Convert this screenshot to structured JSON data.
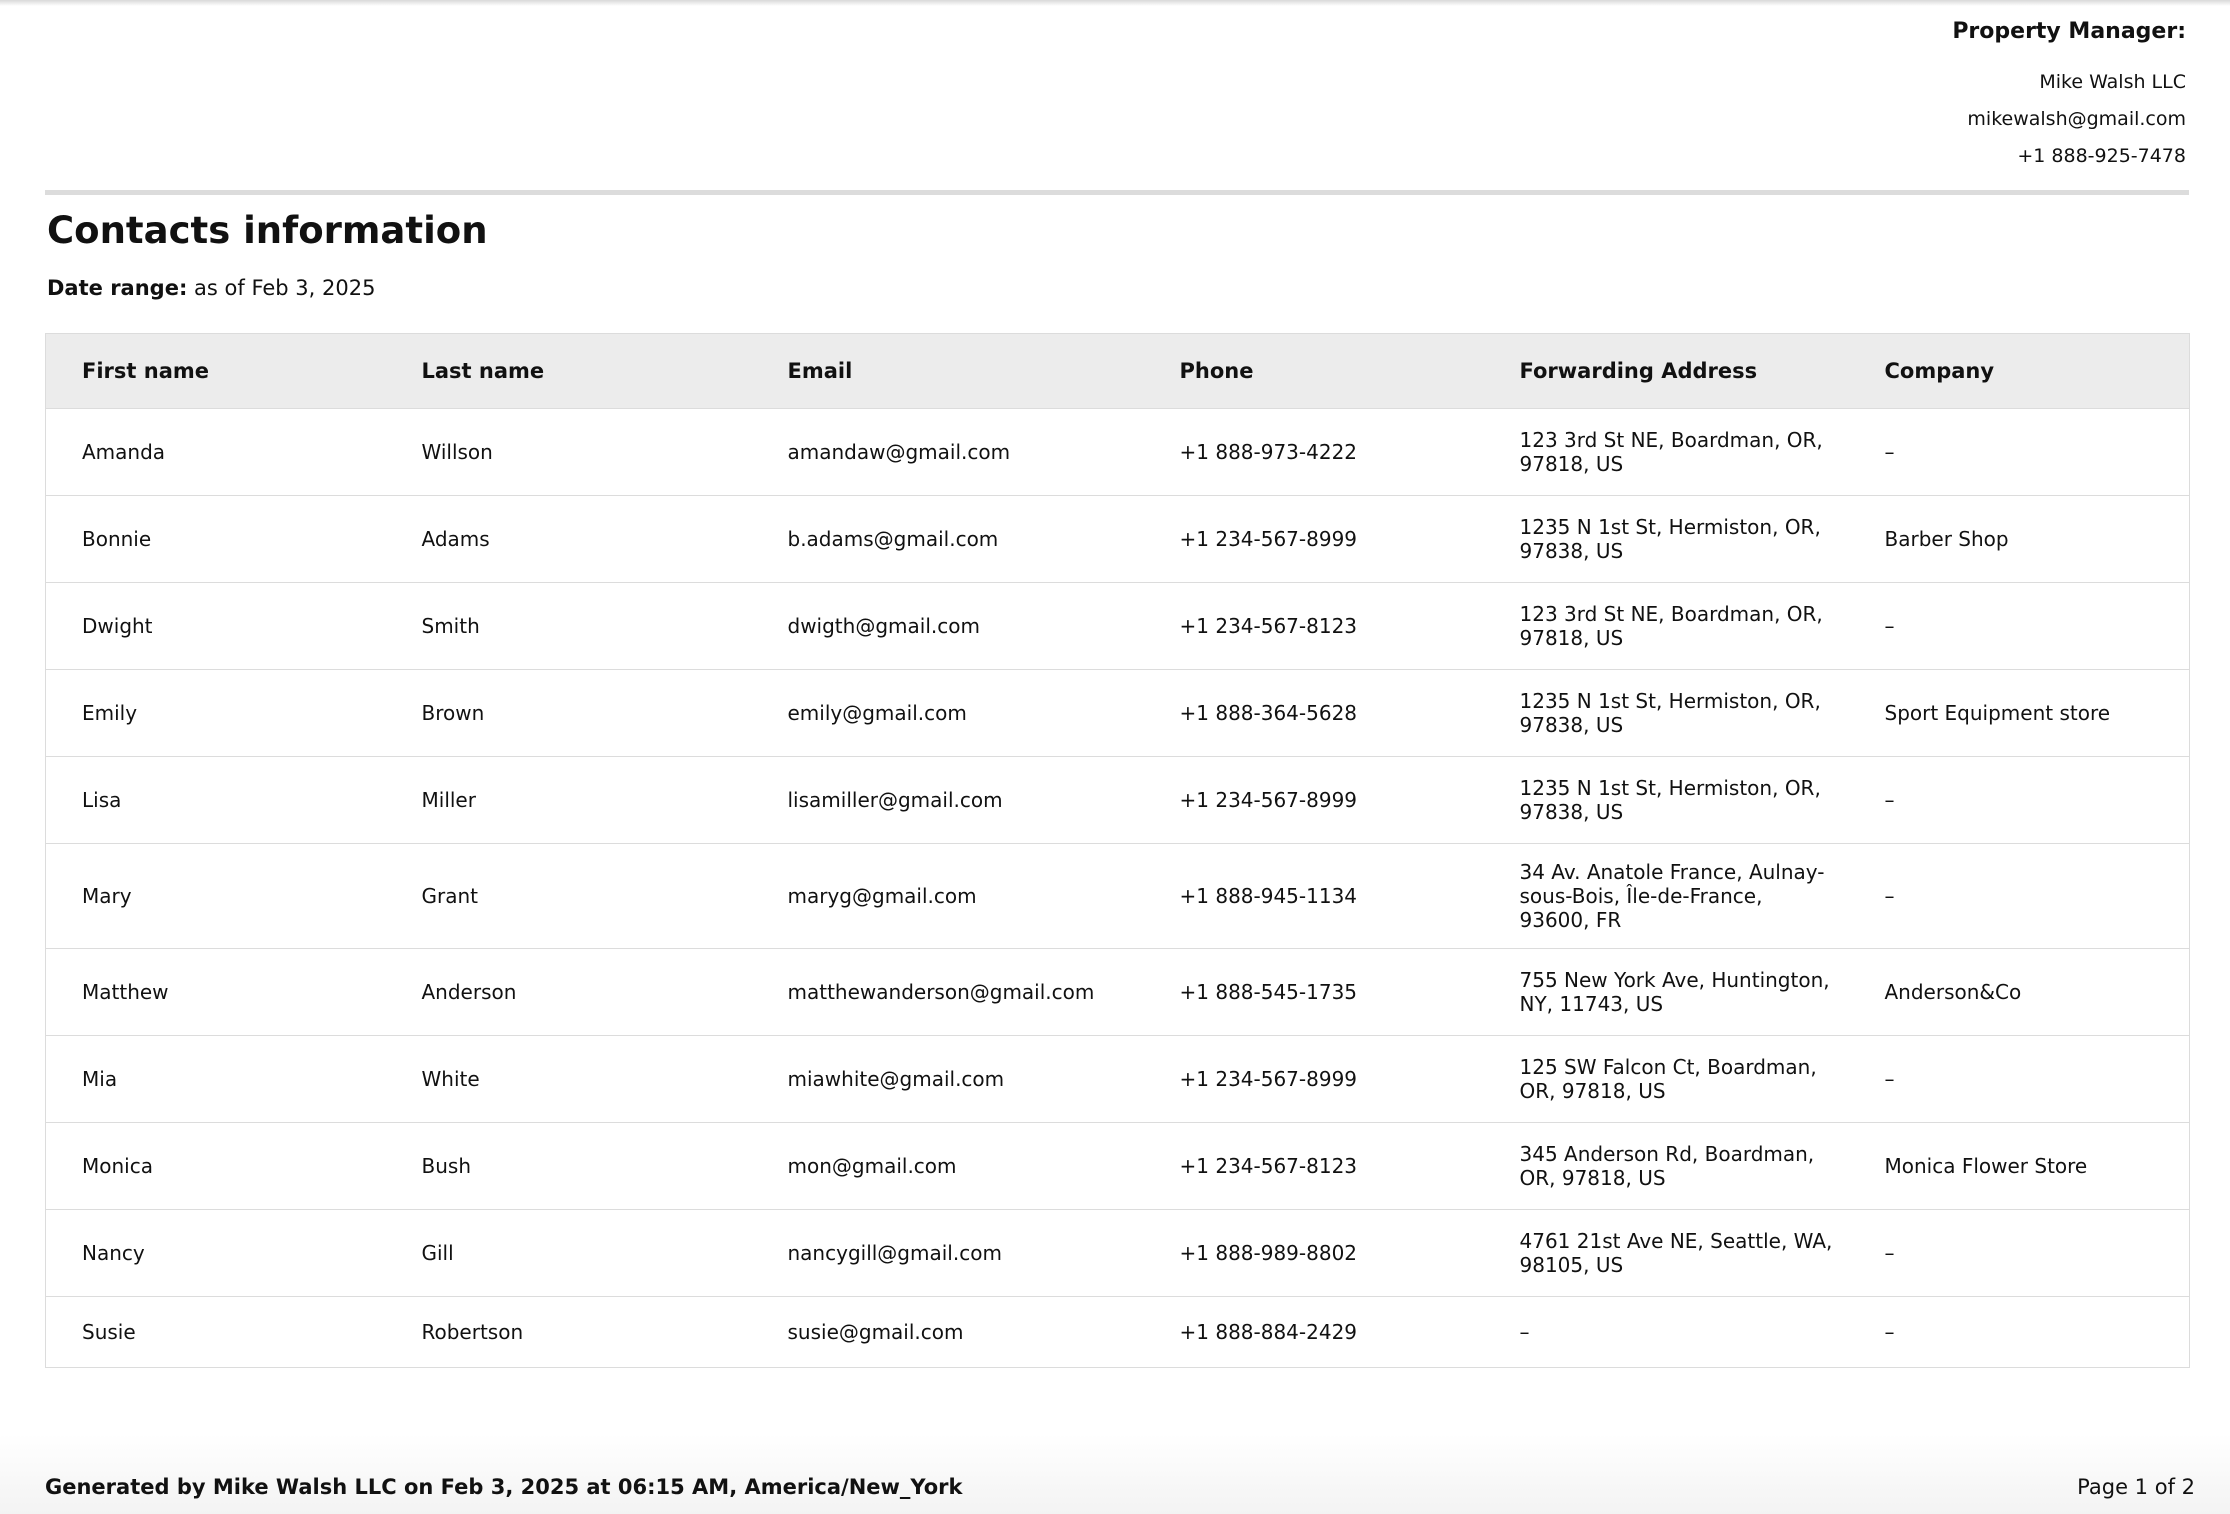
{
  "manager": {
    "heading": "Property Manager:",
    "name": "Mike Walsh LLC",
    "email": "mikewalsh@gmail.com",
    "phone": "+1 888-925-7478"
  },
  "report": {
    "title": "Contacts information",
    "date_range_label": "Date range:",
    "date_range_value": "as of Feb 3, 2025"
  },
  "table": {
    "columns": [
      "First name",
      "Last name",
      "Email",
      "Phone",
      "Forwarding Address",
      "Company"
    ],
    "rows": [
      [
        "Amanda",
        "Willson",
        "amandaw@gmail.com",
        "+1 888-973-4222",
        "123 3rd St NE, Boardman, OR, 97818, US",
        "–"
      ],
      [
        "Bonnie",
        "Adams",
        "b.adams@gmail.com",
        "+1 234-567-8999",
        "1235 N 1st St, Hermiston, OR, 97838, US",
        "Barber Shop"
      ],
      [
        "Dwight",
        "Smith",
        "dwigth@gmail.com",
        "+1 234-567-8123",
        "123 3rd St NE, Boardman, OR, 97818, US",
        "–"
      ],
      [
        "Emily",
        "Brown",
        "emily@gmail.com",
        "+1 888-364-5628",
        "1235 N 1st St, Hermiston, OR, 97838, US",
        "Sport Equipment store"
      ],
      [
        "Lisa",
        "Miller",
        "lisamiller@gmail.com",
        "+1 234-567-8999",
        "1235 N 1st St, Hermiston, OR, 97838, US",
        "–"
      ],
      [
        "Mary",
        "Grant",
        "maryg@gmail.com",
        "+1 888-945-1134",
        "34 Av. Anatole France, Aulnay-sous-Bois, Île-de-France, 93600, FR",
        "–"
      ],
      [
        "Matthew",
        "Anderson",
        "matthewanderson@gmail.com",
        "+1 888-545-1735",
        "755 New York Ave, Huntington, NY, 11743, US",
        "Anderson&Co"
      ],
      [
        "Mia",
        "White",
        "miawhite@gmail.com",
        "+1 234-567-8999",
        "125 SW Falcon Ct, Boardman, OR, 97818, US",
        "–"
      ],
      [
        "Monica",
        "Bush",
        "mon@gmail.com",
        "+1 234-567-8123",
        "345 Anderson Rd, Boardman, OR, 97818, US",
        "Monica Flower Store"
      ],
      [
        "Nancy",
        "Gill",
        "nancygill@gmail.com",
        "+1 888-989-8802",
        "4761 21st Ave NE, Seattle, WA, 98105, US",
        "–"
      ],
      [
        "Susie",
        "Robertson",
        "susie@gmail.com",
        "+1 888-884-2429",
        "–",
        "–"
      ]
    ]
  },
  "footer": {
    "generated": "Generated by Mike Walsh LLC on Feb 3, 2025 at 06:15 AM, America/New_York",
    "page": "Page 1 of 2"
  }
}
